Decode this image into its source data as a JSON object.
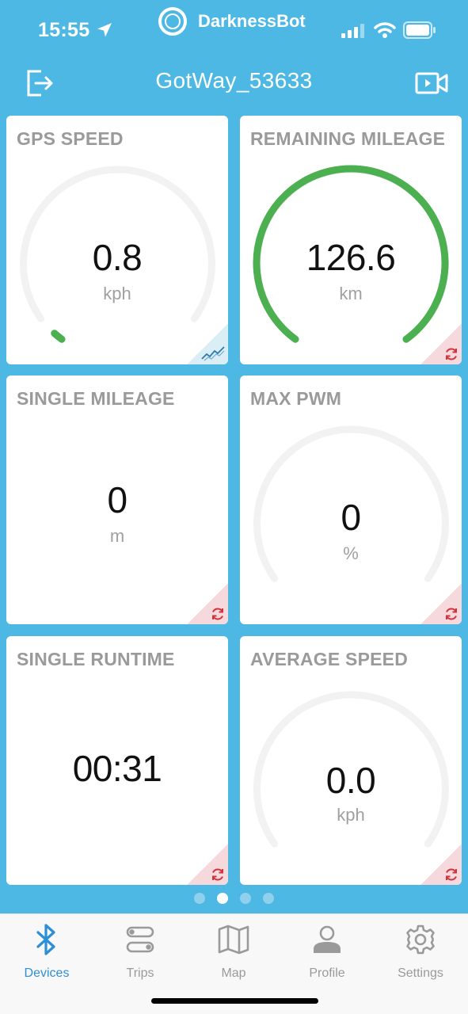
{
  "status_bar": {
    "time": "15:55",
    "app_name": "DarknessBot"
  },
  "header": {
    "title": "GotWay_53633"
  },
  "cards": [
    {
      "label": "GPS SPEED",
      "value": "0.8",
      "unit": "kph",
      "gauge_fraction": 0.02,
      "corner": "chart-icon"
    },
    {
      "label": "REMAINING MILEAGE",
      "value": "126.6",
      "unit": "km",
      "gauge_fraction": 1.0,
      "corner": "reset-icon"
    },
    {
      "label": "SINGLE MILEAGE",
      "value": "0",
      "unit": "m",
      "corner": "reset-icon"
    },
    {
      "label": "MAX PWM",
      "value": "0",
      "unit": "%",
      "gauge_fraction": 0,
      "corner": "reset-icon"
    },
    {
      "label": "SINGLE RUNTIME",
      "value": "00:31",
      "corner": "reset-icon"
    },
    {
      "label": "AVERAGE SPEED",
      "value": "0.0",
      "unit": "kph",
      "gauge_fraction": 0,
      "corner": "reset-icon"
    }
  ],
  "pager": {
    "pages": 4,
    "active": 1
  },
  "tabs": [
    {
      "label": "Devices",
      "icon": "bluetooth-icon",
      "active": true
    },
    {
      "label": "Trips",
      "icon": "route-icon",
      "active": false
    },
    {
      "label": "Map",
      "icon": "map-icon",
      "active": false
    },
    {
      "label": "Profile",
      "icon": "person-icon",
      "active": false
    },
    {
      "label": "Settings",
      "icon": "gear-icon",
      "active": false
    }
  ],
  "colors": {
    "background": "#4db8e4",
    "gauge_active": "#4caf50",
    "gauge_track": "#f2f2f2",
    "tab_active": "#2d8fd5",
    "reset": "#d0343c",
    "chart": "#2a7fb0"
  }
}
